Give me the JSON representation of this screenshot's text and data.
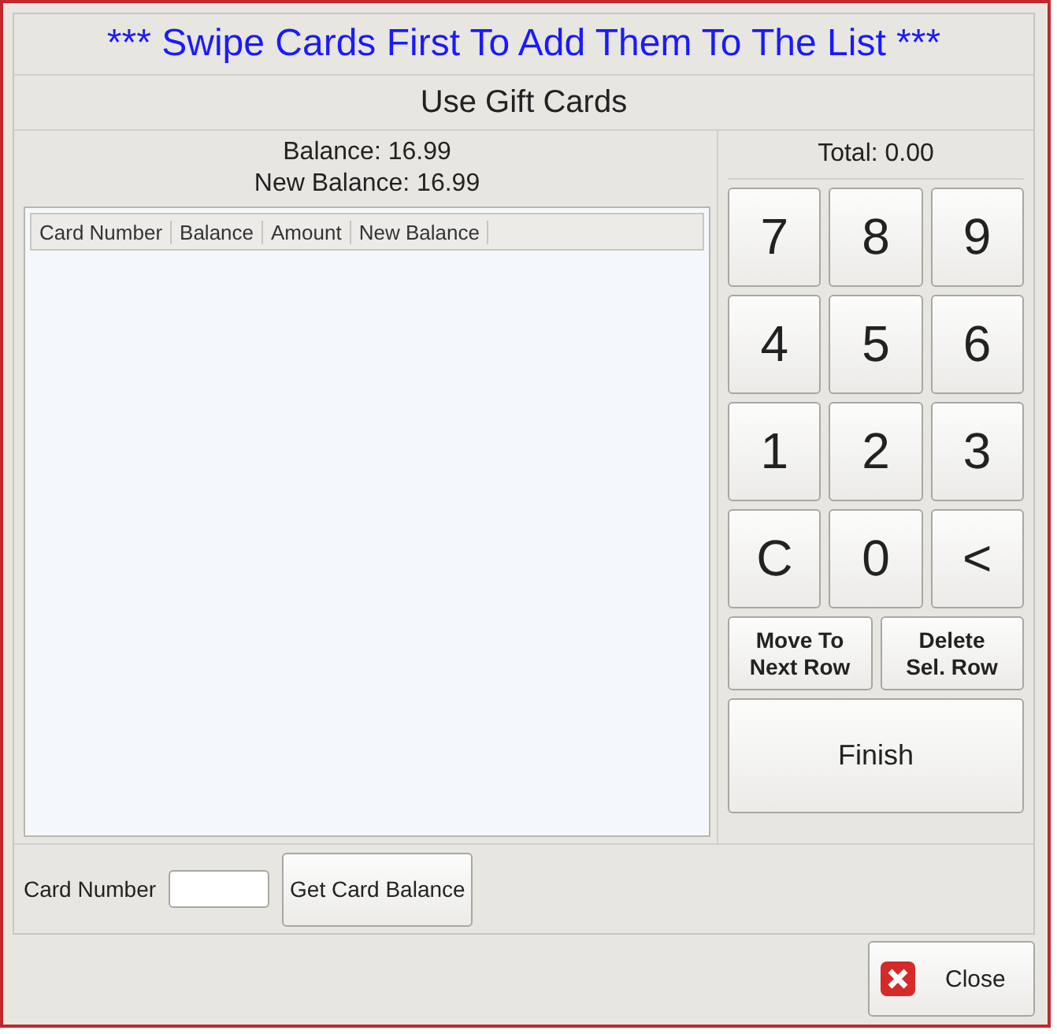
{
  "banner": "*** Swipe Cards First To Add Them To The List ***",
  "title": "Use Gift Cards",
  "balance": "Balance: 16.99",
  "new_balance": "New Balance: 16.99",
  "table": {
    "columns": [
      "Card Number",
      "Balance",
      "Amount",
      "New Balance"
    ]
  },
  "total": "Total: 0.00",
  "keypad": [
    "7",
    "8",
    "9",
    "4",
    "5",
    "6",
    "1",
    "2",
    "3",
    "C",
    "0",
    "<"
  ],
  "row_buttons": [
    "Move To\nNext Row",
    "Delete\nSel. Row"
  ],
  "finish": "Finish",
  "card_number": {
    "label": "Card Number"
  },
  "get_balance": "Get Card Balance",
  "close": "Close"
}
